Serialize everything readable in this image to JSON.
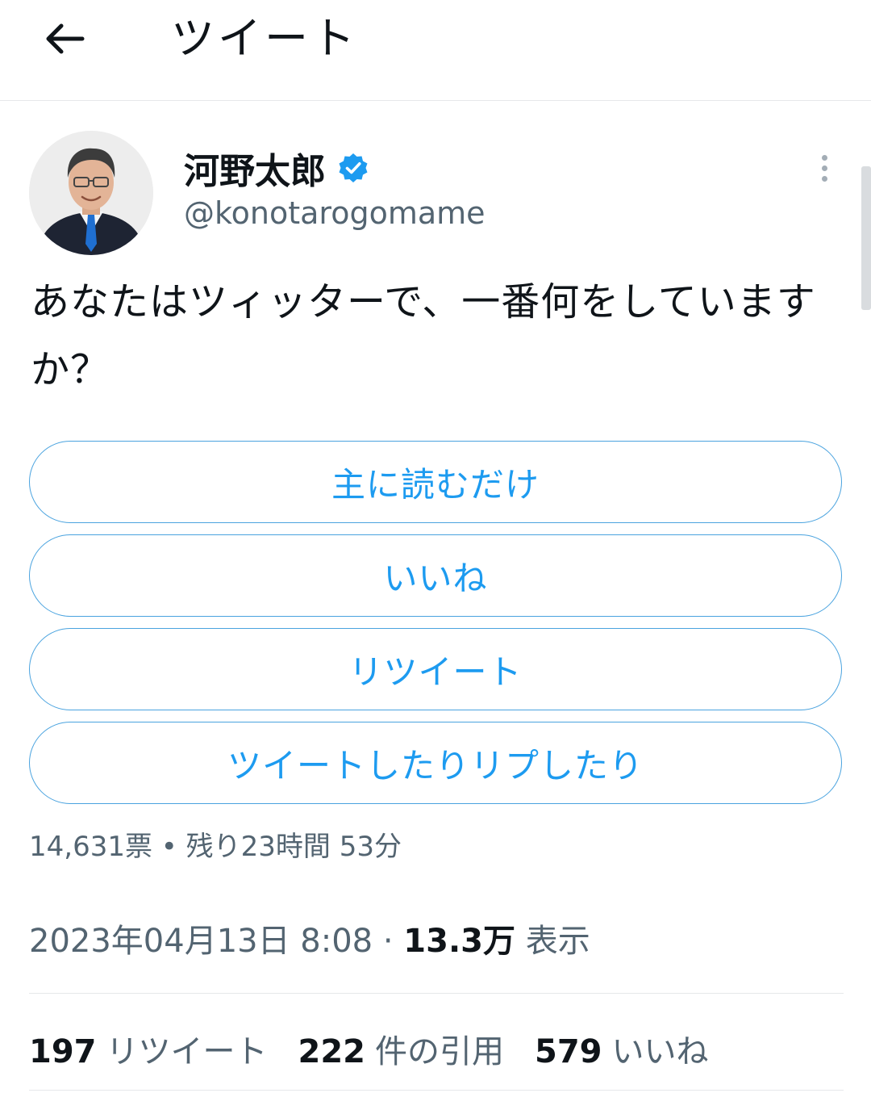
{
  "header": {
    "back_icon": "arrow-left-icon",
    "title": "ツイート"
  },
  "author": {
    "name": "河野太郎",
    "handle": "@konotarogomame",
    "verified": true,
    "verified_icon": "verified-badge-icon",
    "avatar_icon": "profile-photo"
  },
  "tweet": {
    "text": "あなたはツィッターで、一番何をしていますか？"
  },
  "poll": {
    "options": [
      {
        "label": "主に読むだけ"
      },
      {
        "label": "いいね"
      },
      {
        "label": "リツイート"
      },
      {
        "label": "ツイートしたりリプしたり"
      }
    ],
    "meta": "14,631票 • 残り23時間 53分"
  },
  "timestamp": {
    "datetime": "2023年04月13日 8:08",
    "separator": "·",
    "views_count": "13.3万",
    "views_label": "表示"
  },
  "stats": {
    "retweets": {
      "count": "197",
      "label": "リツイート"
    },
    "quotes": {
      "count": "222",
      "label": "件の引用"
    },
    "likes": {
      "count": "579",
      "label": "いいね"
    }
  },
  "colors": {
    "accent": "#1d9bf0",
    "text_primary": "#0f1419",
    "text_secondary": "#536471",
    "divider": "#e6e8ea"
  }
}
